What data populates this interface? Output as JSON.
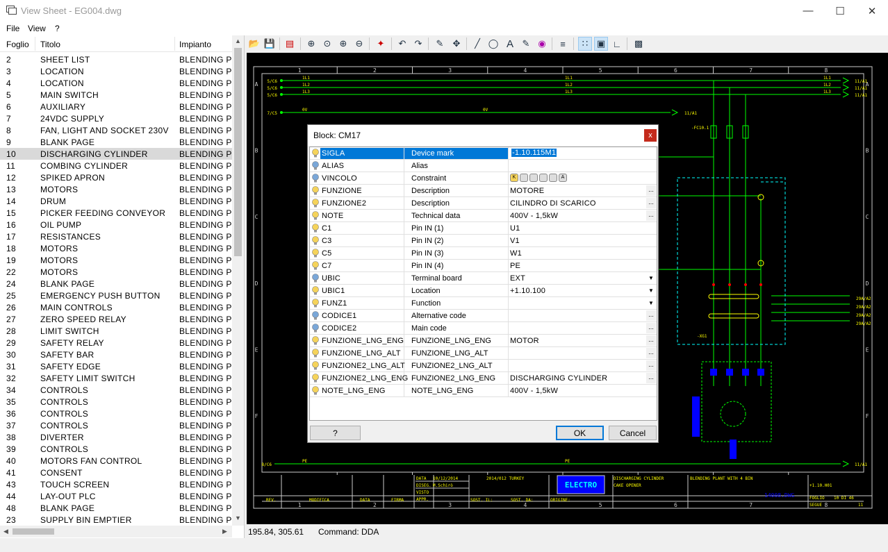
{
  "window": {
    "title": "View Sheet - EG004.dwg"
  },
  "menu": [
    "File",
    "View",
    "?"
  ],
  "sheet_list": {
    "columns": [
      "Foglio",
      "Titolo",
      "Impianto"
    ],
    "selected_index": 8,
    "rows": [
      [
        "2",
        "SHEET LIST",
        "BLENDING PL."
      ],
      [
        "3",
        "LOCATION",
        "BLENDING PL."
      ],
      [
        "4",
        "LOCATION",
        "BLENDING PL."
      ],
      [
        "5",
        "MAIN SWITCH",
        "BLENDING PL."
      ],
      [
        "6",
        "AUXILIARY",
        "BLENDING PL."
      ],
      [
        "7",
        "24VDC SUPPLY",
        "BLENDING PL."
      ],
      [
        "8",
        "FAN, LIGHT AND SOCKET 230V",
        "BLENDING PL."
      ],
      [
        "9",
        "BLANK PAGE",
        "BLENDING PL."
      ],
      [
        "10",
        "DISCHARGING CYLINDER",
        "BLENDING PL."
      ],
      [
        "11",
        "COMBING CYLINDER",
        "BLENDING PL."
      ],
      [
        "12",
        "SPIKED APRON",
        "BLENDING PL."
      ],
      [
        "13",
        "MOTORS",
        "BLENDING PL."
      ],
      [
        "14",
        "DRUM",
        "BLENDING PL."
      ],
      [
        "15",
        "PICKER FEEDING CONVEYOR",
        "BLENDING PL."
      ],
      [
        "16",
        "OIL PUMP",
        "BLENDING PL."
      ],
      [
        "17",
        "RESISTANCES",
        "BLENDING PL."
      ],
      [
        "18",
        "MOTORS",
        "BLENDING PL."
      ],
      [
        "19",
        "MOTORS",
        "BLENDING PL."
      ],
      [
        "22",
        "MOTORS",
        "BLENDING PL."
      ],
      [
        "24",
        "BLANK PAGE",
        "BLENDING PL."
      ],
      [
        "25",
        "EMERGENCY PUSH BUTTON",
        "BLENDING PL."
      ],
      [
        "26",
        "MAIN CONTROLS",
        "BLENDING PL."
      ],
      [
        "27",
        "ZERO SPEED RELAY",
        "BLENDING PL."
      ],
      [
        "28",
        "LIMIT SWITCH",
        "BLENDING PL."
      ],
      [
        "29",
        "SAFETY RELAY",
        "BLENDING PL."
      ],
      [
        "30",
        "SAFETY BAR",
        "BLENDING PL."
      ],
      [
        "31",
        "SAFETY EDGE",
        "BLENDING PL."
      ],
      [
        "32",
        "SAFETY LIMIT SWITCH",
        "BLENDING PL."
      ],
      [
        "34",
        "CONTROLS",
        "BLENDING PL."
      ],
      [
        "35",
        "CONTROLS",
        "BLENDING PL."
      ],
      [
        "36",
        "CONTROLS",
        "BLENDING PL."
      ],
      [
        "37",
        "CONTROLS",
        "BLENDING PL."
      ],
      [
        "38",
        "DIVERTER",
        "BLENDING PL."
      ],
      [
        "39",
        "CONTROLS",
        "BLENDING PL."
      ],
      [
        "40",
        "MOTORS FAN CONTROL",
        "BLENDING PL."
      ],
      [
        "41",
        "CONSENT",
        "BLENDING PL."
      ],
      [
        "43",
        "TOUCH SCREEN",
        "BLENDING PL."
      ],
      [
        "44",
        "LAY-OUT PLC",
        "BLENDING PL."
      ],
      [
        "48",
        "BLANK PAGE",
        "BLENDING PL."
      ],
      [
        "23",
        "SUPPLY BIN EMPTIER",
        "BLENDING PL."
      ]
    ]
  },
  "status": {
    "coords": "195.84, 305.61",
    "command": "Command: DDA"
  },
  "dialog": {
    "title": "Block: CM17",
    "close": "x",
    "help_label": "?",
    "ok_label": "OK",
    "cancel_label": "Cancel",
    "attributes": [
      {
        "key": "SIGLA",
        "desc": "Device mark",
        "value": "-1.10.115M1",
        "bulb": "yellow",
        "editor": "",
        "selected": true
      },
      {
        "key": "ALIAS",
        "desc": "Alias",
        "value": "",
        "bulb": "blue",
        "editor": ""
      },
      {
        "key": "VINCOLO",
        "desc": "Constraint",
        "value": "",
        "bulb": "blue",
        "editor": "icons"
      },
      {
        "key": "FUNZIONE",
        "desc": "Description",
        "value": "MOTORE",
        "bulb": "yellow",
        "editor": "ellipsis"
      },
      {
        "key": "FUNZIONE2",
        "desc": "Description",
        "value": "CILINDRO DI SCARICO",
        "bulb": "yellow",
        "editor": "ellipsis"
      },
      {
        "key": "NOTE",
        "desc": "Technical data",
        "value": "400V - 1,5kW",
        "bulb": "yellow",
        "editor": "ellipsis"
      },
      {
        "key": "C1",
        "desc": "Pin IN (1)",
        "value": "U1",
        "bulb": "yellow",
        "editor": ""
      },
      {
        "key": "C3",
        "desc": "Pin IN (2)",
        "value": "V1",
        "bulb": "yellow",
        "editor": ""
      },
      {
        "key": "C5",
        "desc": "Pin IN (3)",
        "value": "W1",
        "bulb": "yellow",
        "editor": ""
      },
      {
        "key": "C7",
        "desc": "Pin IN (4)",
        "value": "PE",
        "bulb": "yellow",
        "editor": ""
      },
      {
        "key": "UBIC",
        "desc": "Terminal board",
        "value": "EXT",
        "bulb": "blue",
        "editor": "dropdown"
      },
      {
        "key": "UBIC1",
        "desc": "Location",
        "value": "+1.10.100",
        "bulb": "yellow",
        "editor": "dropdown"
      },
      {
        "key": "FUNZ1",
        "desc": "Function",
        "value": "",
        "bulb": "yellow",
        "editor": "dropdown"
      },
      {
        "key": "CODICE1",
        "desc": "Alternative code",
        "value": "",
        "bulb": "blue",
        "editor": "ellipsis"
      },
      {
        "key": "CODICE2",
        "desc": "Main code",
        "value": "",
        "bulb": "blue",
        "editor": "ellipsis"
      },
      {
        "key": "FUNZIONE_LNG_ENG",
        "desc": "FUNZIONE_LNG_ENG",
        "value": "MOTOR",
        "bulb": "yellow",
        "editor": "ellipsis"
      },
      {
        "key": "FUNZIONE_LNG_ALT",
        "desc": "FUNZIONE_LNG_ALT",
        "value": "",
        "bulb": "yellow",
        "editor": "ellipsis"
      },
      {
        "key": "FUNZIONE2_LNG_ALT",
        "desc": "FUNZIONE2_LNG_ALT",
        "value": "",
        "bulb": "yellow",
        "editor": "ellipsis"
      },
      {
        "key": "FUNZIONE2_LNG_ENG",
        "desc": "FUNZIONE2_LNG_ENG",
        "value": "DISCHARGING CYLINDER",
        "bulb": "yellow",
        "editor": "ellipsis"
      },
      {
        "key": "NOTE_LNG_ENG",
        "desc": "NOTE_LNG_ENG",
        "value": "400V - 1,5kW",
        "bulb": "yellow",
        "editor": ""
      }
    ]
  },
  "drawing": {
    "columns": [
      "1",
      "2",
      "3",
      "4",
      "5",
      "6",
      "7",
      "8"
    ],
    "rows": [
      "A",
      "B",
      "C",
      "D",
      "E",
      "F"
    ],
    "wires": [
      {
        "ref": "5/C6",
        "label": "1L1",
        "end": "11/A1"
      },
      {
        "ref": "5/C6",
        "label": "1L2",
        "end": "11/A1"
      },
      {
        "ref": "5/C6",
        "label": "1L3",
        "end": "11/A1"
      },
      {
        "ref": "7/C5",
        "label": "0V",
        "end": "11/A1"
      }
    ],
    "pe_ref": "8/C6",
    "pe_label": "PE",
    "pe_end": "11/A1",
    "fuse_label": "-FC10.1",
    "terminal_label": "-XG1",
    "right_refs": [
      "29A/A2",
      "29A/A2",
      "29A/A2",
      "29A/A2"
    ],
    "title_block": {
      "date_label": "DATA",
      "date_value": "10/12/2014",
      "dis_label": "DISEG.",
      "dis_value": "M.Schirò",
      "visto_label": "VISTO",
      "appr_label": "APPR.",
      "job": "2014/012 TURKEY",
      "logo": "ELECTRO",
      "desc1": "DISCHARGING CYLINDER",
      "desc2": "CAKE OPENER",
      "plant": "BLENDING PLANT WITH 4 BIN",
      "file": "14008.DWG",
      "loc": "+1.10.H01",
      "sheet_label": "FOGLIO",
      "sheet_value": "10 DI 46",
      "segue_label": "SEGUE",
      "segue_value": "11",
      "rev": "REV.",
      "modifica": "MODIFICA",
      "data": "DATA",
      "firma": "FIRMA",
      "sost_il": "SOST. IL:",
      "sost_da": "SOST. DA:",
      "origine": "ORIGINE:"
    }
  }
}
